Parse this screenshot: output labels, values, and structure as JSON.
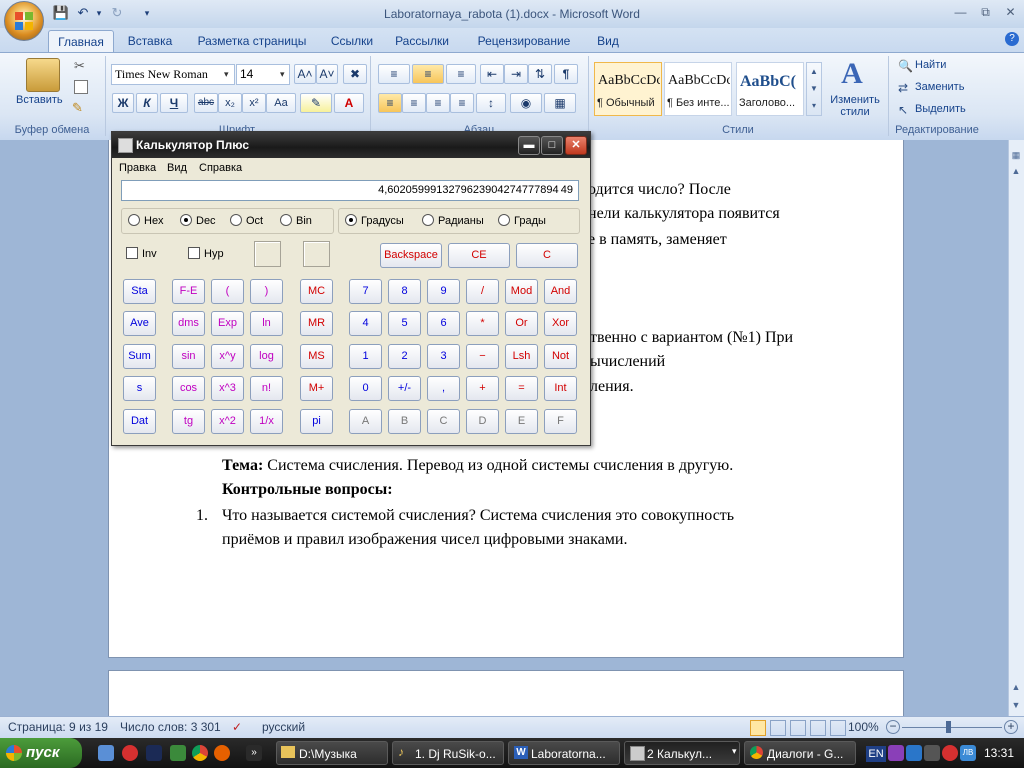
{
  "word": {
    "window_title": "Laboratornaya_rabota (1).docx - Microsoft Word",
    "tabs": [
      "Главная",
      "Вставка",
      "Разметка страницы",
      "Ссылки",
      "Рассылки",
      "Рецензирование",
      "Вид"
    ],
    "ribbon": {
      "paste_label": "Вставить",
      "font_name": "Times New Roman",
      "font_size": "14",
      "groups": [
        "Буфер обмена",
        "Шрифт",
        "Абзац",
        "Стили",
        "Редактирование"
      ],
      "styles": [
        {
          "sample": "AaBbCcDc",
          "name": "¶ Обычный"
        },
        {
          "sample": "AaBbCcDc",
          "name": "¶ Без инте..."
        },
        {
          "sample": "AaBbC(",
          "name": "Заголово..."
        }
      ],
      "change_styles": "Изменить стили",
      "find": "Найти",
      "replace": "Заменить",
      "select": "Выделить"
    },
    "document": {
      "line1_tail": "одится число? После",
      "line2_tail": "нели калькулятора появится",
      "line3_tail": "е в память, заменяет",
      "line4_tail": "твенно с вариантом (№1) При",
      "line5_tail": "ычислений",
      "line6_tail": "ления.",
      "topic_label": "Тема:",
      "topic_text": " Система счисления. Перевод из одной системы  счисления в другую.",
      "questions_heading": "Контрольные вопросы:",
      "q1_number": "1.",
      "q1_line1": "Что называется системой счисления? Система счисления это  совокупность",
      "q1_line2": "приёмов и правил изображения чисел цифровыми знаками."
    },
    "status": {
      "page": "Страница: 9 из 19",
      "words": "Число слов: 3 301",
      "language": "русский",
      "zoom": "100%"
    }
  },
  "calculator": {
    "title": "Калькулятор Плюс",
    "menu": [
      "Правка",
      "Вид",
      "Справка"
    ],
    "display": "4,6020599913279623904274777894 49",
    "number_base": [
      "Hex",
      "Dec",
      "Oct",
      "Bin"
    ],
    "number_base_selected": "Dec",
    "angle_units": [
      "Градусы",
      "Радианы",
      "Грады"
    ],
    "angle_selected": "Градусы",
    "inv_label": "Inv",
    "hyp_label": "Hyp",
    "backspace": "Backspace",
    "ce": "CE",
    "clear": "C",
    "stat_keys": [
      "Sta",
      "Ave",
      "Sum",
      "s",
      "Dat"
    ],
    "sci_keys": [
      [
        "F-E",
        "(",
        ")"
      ],
      [
        "dms",
        "Exp",
        "ln"
      ],
      [
        "sin",
        "x^y",
        "log"
      ],
      [
        "cos",
        "x^3",
        "n!"
      ],
      [
        "tg",
        "x^2",
        "1/x"
      ]
    ],
    "mem_keys": [
      "MC",
      "MR",
      "MS",
      "M+",
      "pi"
    ],
    "num_keys": [
      [
        "7",
        "8",
        "9",
        "/",
        "Mod",
        "And"
      ],
      [
        "4",
        "5",
        "6",
        "*",
        "Or",
        "Xor"
      ],
      [
        "1",
        "2",
        "3",
        "−",
        "Lsh",
        "Not"
      ],
      [
        "0",
        "+/-",
        ",",
        "+",
        "=",
        "Int"
      ],
      [
        "A",
        "B",
        "C",
        "D",
        "E",
        "F"
      ]
    ]
  },
  "taskbar": {
    "start": "пуск",
    "tasks": [
      "D:\\Музыка",
      "1. Dj RuSik-o...",
      "Laboratorna...",
      "2 Калькул...",
      "Диалоги - G..."
    ],
    "lang": "EN",
    "clock": "13:31"
  }
}
